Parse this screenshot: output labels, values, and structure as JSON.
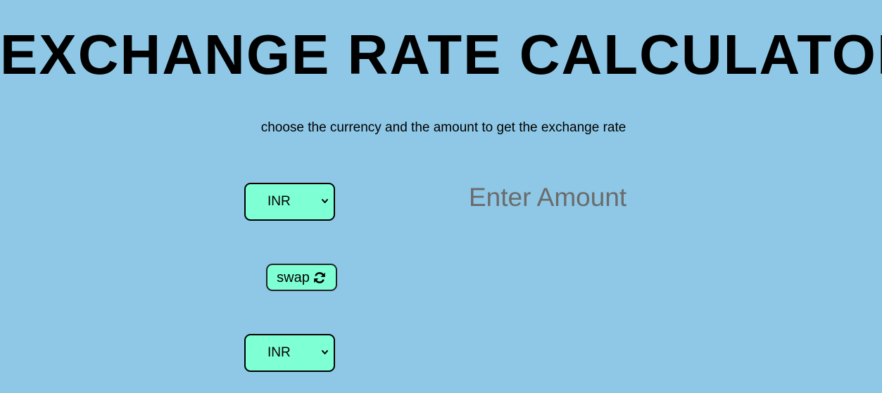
{
  "header": {
    "title": "EXCHANGE RATE CALCULATOR",
    "subtitle": "choose the currency and the amount to get the exchange rate"
  },
  "converter": {
    "from_currency": "INR",
    "to_currency": "INR",
    "swap_label": "swap",
    "swap_icon": "refresh-icon",
    "select_icon": "chevron-down-icon",
    "amount_value": "",
    "amount_placeholder": "Enter Amount"
  },
  "colors": {
    "background": "#8ec8e6",
    "control_fill": "#7fffd4",
    "placeholder_text": "#6b6b6b"
  }
}
